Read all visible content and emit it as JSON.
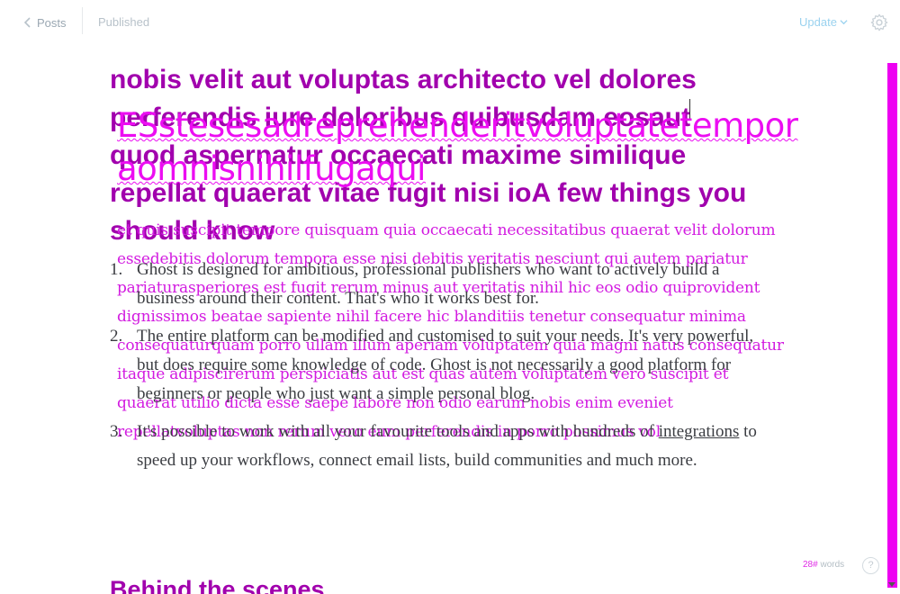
{
  "toolbar": {
    "back_label": "Posts",
    "status": "Published",
    "update_label": "Update"
  },
  "post": {
    "title": "nobis velit aut voluptas architecto vel dolores perferendis iure doloribus quibusdam eosaut quod aspernatur occaecati maxime similique repellat quaerat vitae fugit nisi ioA few things you should know",
    "overlay_title": "ESstesesadreprehenderitvoluptatetemporaomnisnihilfugaqui",
    "overlay_excerpt": "et quis suscipit tempore quisquam quia occaecati necessitatibus quaerat velit dolorum essedebitis dolorum tempora esse nisi debitis veritatis nesciunt qui autem pariatur pariaturasperiores est fugit rerum minus aut veritatis nihil hic eos odio quiprovident dignissimos beatae sapiente nihil facere hic blanditiis tenetur consequatur minima consequaturquam porro ullam illum aperiam voluptatem quia magni natus consequatur itaque adipiscirerum perspiciatis aut est quas autem voluptatem vero suscipit et quaerat utilio dicta esse saepe labore non odio earum nobis enim eveniet repellatvoluptas non rerum vero eum perferendis in porro possimus vol",
    "list": [
      {
        "number": "1.",
        "text": "Ghost is designed for ambitious, professional publishers who want to actively build a business around their content. That's who it works best for."
      },
      {
        "number": "2.",
        "text": "The entire platform can be modified and customised to suit your needs. It's very powerful, but does require some knowledge of code. Ghost is not necessarily a good platform for beginners or people who just want a simple personal blog."
      },
      {
        "number": "3.",
        "text_before": "It's possible to work with all your favourite tools and apps with hundreds of ",
        "link": "integrations",
        "text_after": " to speed up your workflows, connect email lists, build communities and much more."
      }
    ],
    "subheading": "Behind the scenes"
  },
  "footer": {
    "word_count": "28#",
    "word_label": "words",
    "help": "?"
  },
  "colors": {
    "title": "#a100ad",
    "overlay": "#ec0df2",
    "accent_blue": "#9ad2ef",
    "scrollbar": "#ee00f2"
  },
  "icons": [
    "chevron-left-icon",
    "chevron-down-icon",
    "gear-icon",
    "help-icon"
  ]
}
